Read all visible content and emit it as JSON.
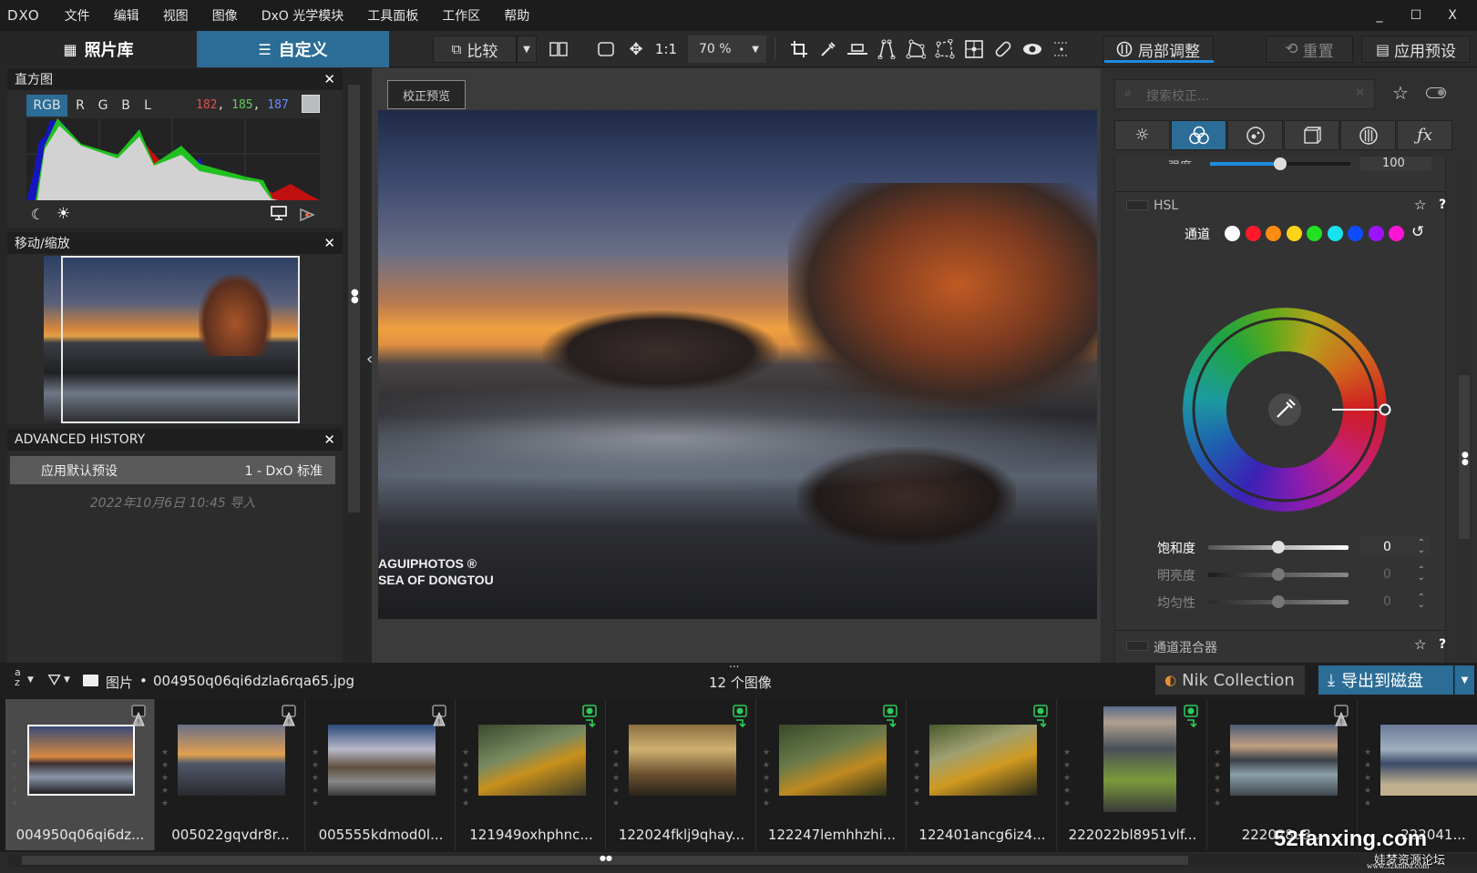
{
  "app": {
    "logo": "DXO",
    "menu": [
      "文件",
      "编辑",
      "视图",
      "图像",
      "DxO 光学模块",
      "工具面板",
      "工作区",
      "帮助"
    ],
    "window_controls": {
      "minimize": "_",
      "maximize": "☐",
      "close": "X"
    }
  },
  "toolbar": {
    "tabs": [
      {
        "label": "照片库",
        "icon": "grid-icon",
        "active": false
      },
      {
        "label": "自定义",
        "icon": "sliders-icon",
        "active": true
      }
    ],
    "compare_label": "比较",
    "one_to_one": "1:1",
    "zoom_value": "70 %",
    "local_adjust_label": "局部调整",
    "reset_label": "重置",
    "apply_preset_label": "应用预设",
    "accent_color": "#2b6d97"
  },
  "histogram": {
    "title": "直方图",
    "channels": [
      "RGB",
      "R",
      "G",
      "B",
      "L"
    ],
    "active_channel": "RGB",
    "readout": {
      "r": "182",
      "g": "185",
      "b": "187"
    },
    "readout_sep": ","
  },
  "navigator": {
    "title": "移动/缩放"
  },
  "history": {
    "title": "ADVANCED HISTORY",
    "entries": [
      {
        "label": "应用默认预设",
        "value": "1 - DxO 标准"
      }
    ],
    "import_note": "2022年10月6日 10:45 导入"
  },
  "viewer": {
    "preview_button": "校正预览",
    "watermark_line1": "AGUIPHOTOS ®",
    "watermark_line2": "SEA OF DONGTOU"
  },
  "right_panel": {
    "search_placeholder": "搜索校正...",
    "palette_tabs": [
      "light-icon",
      "color-icon",
      "detail-icon",
      "geometry-icon",
      "local-icon",
      "fx-icon"
    ],
    "active_tab": 1,
    "intensity_label": "强度",
    "intensity_value": "100",
    "intensity_fraction": 0.5,
    "hsl": {
      "title": "HSL",
      "channel_label": "通道",
      "channels": [
        {
          "name": "all",
          "color": "#ffffff"
        },
        {
          "name": "red",
          "color": "#ff1a2b"
        },
        {
          "name": "orange",
          "color": "#ff8c10"
        },
        {
          "name": "yellow",
          "color": "#ffd21a"
        },
        {
          "name": "green",
          "color": "#22e022"
        },
        {
          "name": "cyan",
          "color": "#16e2ee"
        },
        {
          "name": "blue",
          "color": "#0f4cff"
        },
        {
          "name": "purple",
          "color": "#9a14ff"
        },
        {
          "name": "magenta",
          "color": "#ff14d8"
        }
      ],
      "saturation": {
        "label": "饱和度",
        "value": "0",
        "fraction": 0.5
      },
      "luminance": {
        "label": "明亮度",
        "value": "0",
        "fraction": 0.5
      },
      "uniformity": {
        "label": "均匀性",
        "value": "0",
        "fraction": 0.5
      }
    },
    "channel_mixer_title": "通道混合器",
    "help": "?"
  },
  "filmstrip": {
    "sort_label": "a z",
    "folder": "图片",
    "current_file": "004950q06qi6dzla6rqa65.jpg",
    "count_label": "12 个图像",
    "more": "...",
    "nik_label": "Nik Collection",
    "export_label": "导出到磁盘",
    "items": [
      {
        "name": "004950q06qi6dz...",
        "badge": "processing",
        "selected": true
      },
      {
        "name": "005022gqvdr8r...",
        "badge": "processing",
        "selected": false
      },
      {
        "name": "005555kdmod0l...",
        "badge": "processing",
        "selected": false
      },
      {
        "name": "121949oxhphnc...",
        "badge": "ok",
        "selected": false
      },
      {
        "name": "122024fklj9qhay...",
        "badge": "ok",
        "selected": false
      },
      {
        "name": "122247lemhhzhi...",
        "badge": "ok",
        "selected": false
      },
      {
        "name": "122401ancg6iz4...",
        "badge": "ok",
        "selected": false
      },
      {
        "name": "222022bl8951vlf...",
        "badge": "ok",
        "selected": false
      },
      {
        "name": "222028u3...",
        "badge": "processing",
        "selected": false
      },
      {
        "name": "222041...",
        "badge": "none",
        "selected": false
      }
    ]
  },
  "overlay_watermark": {
    "line1": "52fanxing.com",
    "line2": "娃梦资源论坛",
    "line3": "www.52kuibu.com"
  }
}
